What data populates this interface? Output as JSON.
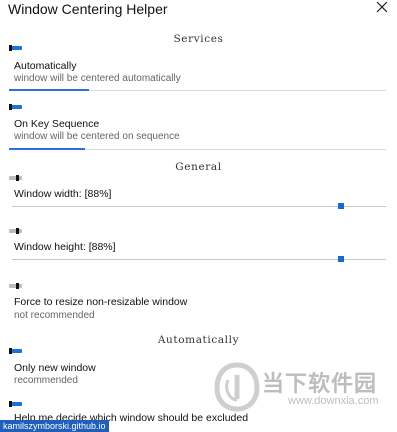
{
  "window": {
    "title": "Window Centering Helper",
    "close_icon": "close-icon"
  },
  "sections": {
    "services": "Services",
    "general": "General",
    "automatically": "Automatically"
  },
  "settings": {
    "automatically": {
      "label": "Automatically",
      "description": "window will be centered automatically",
      "enabled": true
    },
    "on_key_sequence": {
      "label": "On Key Sequence",
      "description": "window will be centered on sequence",
      "enabled": true
    },
    "window_width": {
      "label": "Window width: [88%]",
      "enabled": false,
      "value_percent": 88
    },
    "window_height": {
      "label": "Window height: [88%]",
      "enabled": false,
      "value_percent": 88
    },
    "force_resize": {
      "label": "Force to resize non-resizable window",
      "description": "not recommended",
      "enabled": false
    },
    "only_new_window": {
      "label": "Only new window",
      "description": "recommended",
      "enabled": true
    },
    "help_decide": {
      "label": "Help me decide which window should be excluded",
      "enabled": true
    }
  },
  "footer": {
    "link_text": "kamilszymborski.github.io"
  },
  "watermark": {
    "chinese_text": "当下软件园",
    "url": "www.downxia.com"
  },
  "colors": {
    "accent": "#1d73d8",
    "toggle_off": "#bcbcbc",
    "link_bg": "#1f5fb8",
    "watermark": "#bdbdbd"
  }
}
